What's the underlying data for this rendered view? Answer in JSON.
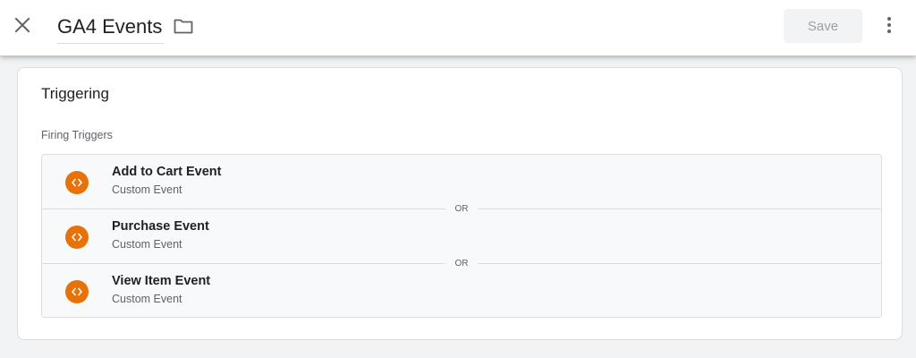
{
  "header": {
    "title": "GA4 Events",
    "save_label": "Save",
    "close_icon": "close-icon",
    "folder_icon": "folder-icon",
    "more_icon": "more-vert-icon"
  },
  "triggering": {
    "section_title": "Triggering",
    "firing_label": "Firing Triggers",
    "separator_label": "OR",
    "triggers": [
      {
        "name": "Add to Cart Event",
        "type": "Custom Event",
        "icon": "custom-event-icon"
      },
      {
        "name": "Purchase Event",
        "type": "Custom Event",
        "icon": "custom-event-icon"
      },
      {
        "name": "View Item Event",
        "type": "Custom Event",
        "icon": "custom-event-icon"
      }
    ]
  },
  "colors": {
    "trigger_icon_bg": "#e8710a",
    "page_bg": "#f1f3f4",
    "card_bg": "#ffffff"
  }
}
